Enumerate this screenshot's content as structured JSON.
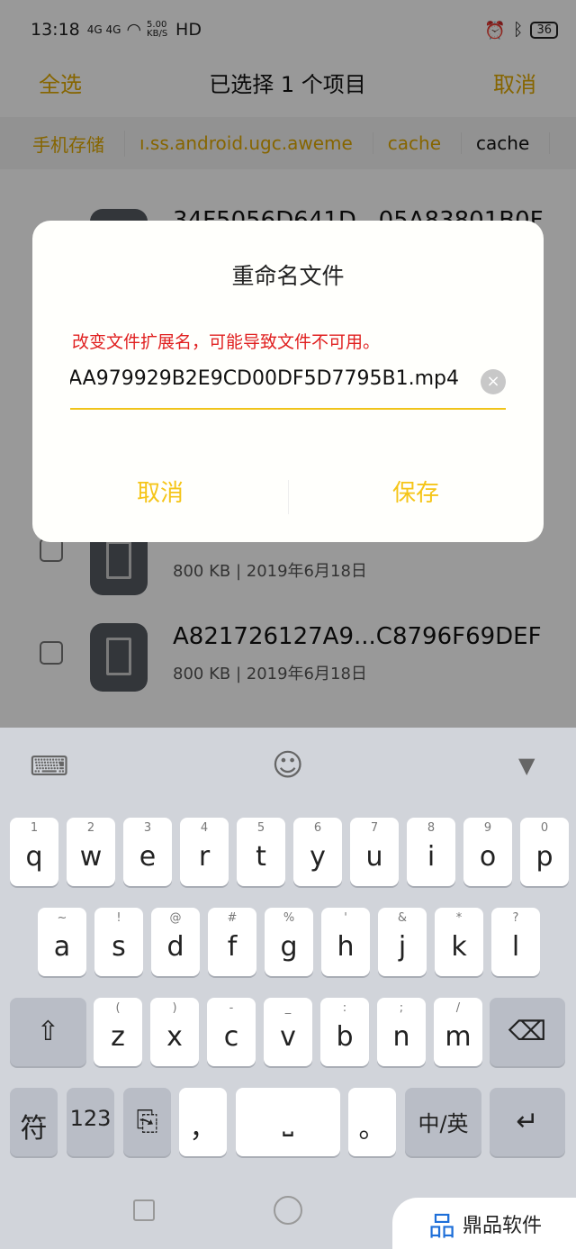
{
  "status": {
    "time": "13:18",
    "signal": "4G 4G",
    "speed": "5.00 KB/S",
    "hd": "HD",
    "battery": "36"
  },
  "header": {
    "select_all": "全选",
    "title": "已选择 1 个项目",
    "cancel": "取消"
  },
  "breadcrumb": [
    "手机存储",
    "ı.ss.android.ugc.aweme",
    "cache",
    "cache"
  ],
  "files": [
    {
      "name": "34F5056D641D...05A83801B0F",
      "meta": ""
    },
    {
      "name": "",
      "meta": "800 KB | 2019年6月18日"
    },
    {
      "name": "A821726127A9...C8796F69DEF",
      "meta": "800 KB | 2019年6月18日"
    }
  ],
  "dialog": {
    "title": "重命名文件",
    "warning": "改变文件扩展名，可能导致文件不可用。",
    "value": "AA979929B2E9CD00DF5D7795B1.mp4",
    "cancel": "取消",
    "save": "保存"
  },
  "keyboard": {
    "row1": [
      [
        "1",
        "q"
      ],
      [
        "2",
        "w"
      ],
      [
        "3",
        "e"
      ],
      [
        "4",
        "r"
      ],
      [
        "5",
        "t"
      ],
      [
        "6",
        "y"
      ],
      [
        "7",
        "u"
      ],
      [
        "8",
        "i"
      ],
      [
        "9",
        "o"
      ],
      [
        "0",
        "p"
      ]
    ],
    "row2": [
      [
        "~",
        "a"
      ],
      [
        "!",
        "s"
      ],
      [
        "@",
        "d"
      ],
      [
        "#",
        "f"
      ],
      [
        "%",
        "g"
      ],
      [
        "'",
        "h"
      ],
      [
        "&",
        "j"
      ],
      [
        "*",
        "k"
      ],
      [
        "?",
        "l"
      ]
    ],
    "row3": [
      [
        "(",
        "z"
      ],
      [
        ")",
        "x"
      ],
      [
        "-",
        "c"
      ],
      [
        "_",
        "v"
      ],
      [
        ":",
        "b"
      ],
      [
        ";",
        "n"
      ],
      [
        "/",
        "m"
      ]
    ],
    "symbols": "符",
    "numbers": "123",
    "comma": "，",
    "period": "。",
    "lang": "中/英"
  },
  "watermark": "鼎品软件",
  "colors": {
    "accent": "#f5c518",
    "warning": "#e02020"
  }
}
